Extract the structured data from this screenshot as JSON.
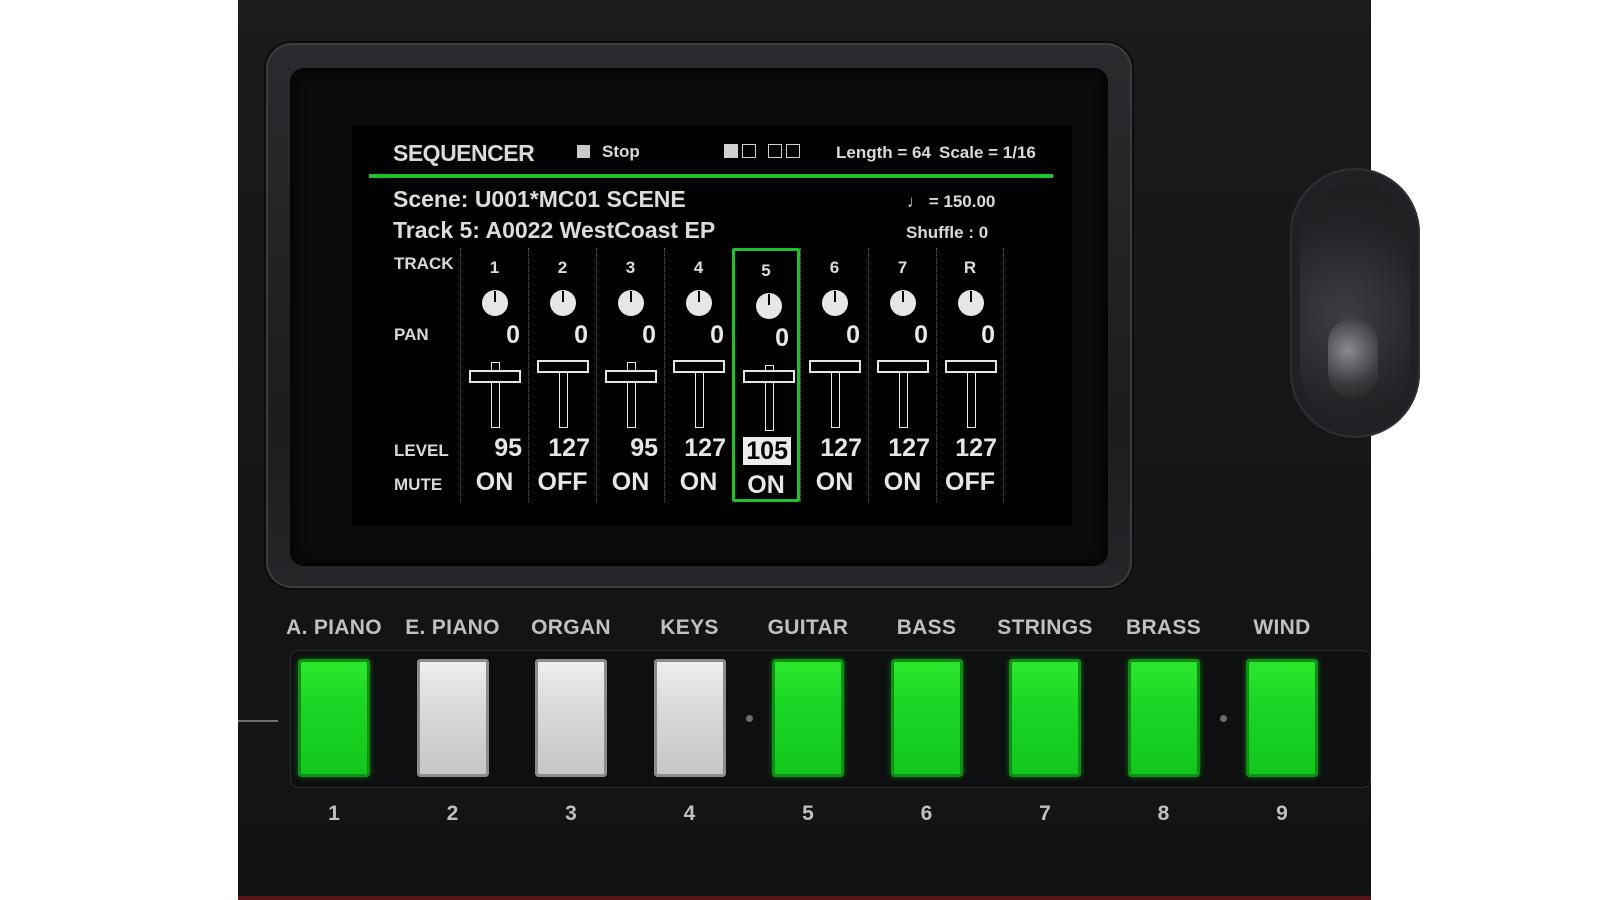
{
  "display": {
    "title": "SEQUENCER",
    "status": "Stop",
    "length": "Length = 64",
    "scale": "Scale = 1/16",
    "scene": "Scene:  U001*MC01 SCENE",
    "track": "Track 5: A0022  WestCoast EP",
    "tempo": "♩ = 150.00",
    "shuffle": "Shuffle :   0",
    "row_labels": {
      "track": "TRACK",
      "pan": "PAN",
      "level": "LEVEL",
      "mute": "MUTE"
    },
    "tracks": [
      {
        "num": "1",
        "pan": "0",
        "level": "95",
        "mute": "ON",
        "fader": 0.75
      },
      {
        "num": "2",
        "pan": "0",
        "level": "127",
        "mute": "OFF",
        "fader": 1.0
      },
      {
        "num": "3",
        "pan": "0",
        "level": "95",
        "mute": "ON",
        "fader": 0.75
      },
      {
        "num": "4",
        "pan": "0",
        "level": "127",
        "mute": "ON",
        "fader": 1.0
      },
      {
        "num": "5",
        "pan": "0",
        "level": "105",
        "mute": "ON",
        "fader": 0.83
      },
      {
        "num": "6",
        "pan": "0",
        "level": "127",
        "mute": "ON",
        "fader": 1.0
      },
      {
        "num": "7",
        "pan": "0",
        "level": "127",
        "mute": "ON",
        "fader": 1.0
      },
      {
        "num": "R",
        "pan": "0",
        "level": "127",
        "mute": "OFF",
        "fader": 1.0
      }
    ],
    "selected_track": "5",
    "accent_color": "#1fc22a"
  },
  "categories": [
    {
      "label": "A. PIANO",
      "num": "1",
      "lit": "green"
    },
    {
      "label": "E. PIANO",
      "num": "2",
      "lit": "white"
    },
    {
      "label": "ORGAN",
      "num": "3",
      "lit": "white"
    },
    {
      "label": "KEYS",
      "num": "4",
      "lit": "white"
    },
    {
      "label": "GUITAR",
      "num": "5",
      "lit": "green"
    },
    {
      "label": "BASS",
      "num": "6",
      "lit": "green"
    },
    {
      "label": "STRINGS",
      "num": "7",
      "lit": "green"
    },
    {
      "label": "BRASS",
      "num": "8",
      "lit": "green"
    },
    {
      "label": "WIND",
      "num": "9",
      "lit": "green"
    }
  ]
}
